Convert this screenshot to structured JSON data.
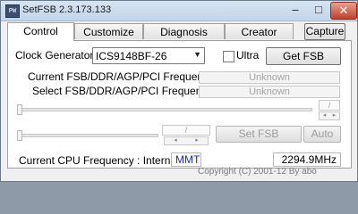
{
  "window": {
    "title": "SetFSB 2.3.173.133",
    "app_icon": "PW",
    "controls": {
      "minimize": "–",
      "maximize": "□",
      "close": "✕"
    }
  },
  "tabs": [
    {
      "label": "Control",
      "active": true
    },
    {
      "label": "Customize",
      "active": false
    },
    {
      "label": "Diagnosis",
      "active": false
    },
    {
      "label": "Creator",
      "active": false
    }
  ],
  "capture_button": "Capture",
  "control": {
    "clock_generator_label": "Clock Generator",
    "clock_generator_value": "ICS9148BF-26",
    "ultra_label": "Ultra",
    "ultra_checked": false,
    "get_fsb_button": "Get FSB",
    "current_freq_label": "Current FSB/DDR/AGP/PCI Frequency",
    "current_freq_value": "Unknown",
    "select_freq_label": "Select FSB/DDR/AGP/PCI Frequency",
    "select_freq_value": "Unknown",
    "slider_1": {
      "field": "/",
      "spin_down": "◂",
      "spin_up": "▸"
    },
    "slider_2": {
      "field": "/",
      "spin_down": "◂",
      "spin_up": "▸"
    },
    "set_fsb_button": "Set FSB",
    "auto_button": "Auto"
  },
  "status": {
    "cpu_label": "Current CPU Frequency : Internal",
    "mode": "MMT",
    "cpu_frequency": "2294.9MHz",
    "copyright": "Copyright (C) 2001-12 By abo"
  },
  "colors": {
    "mode_text": "#1c2fb5",
    "disabled_text": "#9a9a9a",
    "title_bar": "#c8d8ec",
    "close_button": "#c9463a"
  }
}
